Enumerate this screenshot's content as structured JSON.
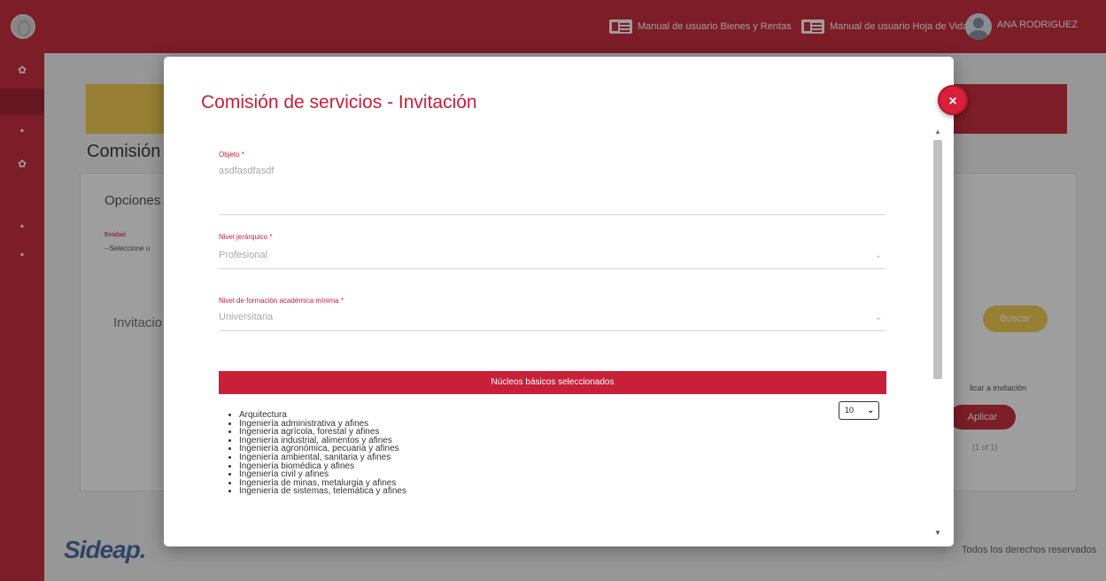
{
  "header": {
    "manual_bienes": "Manual de usuario Bienes y Rentas",
    "manual_hoja": "Manual de usuario Hoja de Vida",
    "user_name": "ANA RODRIGUEZ"
  },
  "background": {
    "page_title": "Comisión",
    "options_title": "Opciones",
    "entity_label": "Entidad",
    "entity_value": "--Seleccione u",
    "invitations_title": "Invitacio",
    "search_button": "Buscar",
    "apply_column": "licar a invitación",
    "apply_button": "Aplicar",
    "pagination": "(1 of 1)",
    "footer_logo": "Sideap.",
    "footer_rights": "Todos los derechos reservados"
  },
  "modal": {
    "title": "Comisión de servicios - Invitación",
    "close_label": "×",
    "objeto": {
      "label": "Objeto *",
      "value": "asdfasdfasdf"
    },
    "nivel_jerarquico": {
      "label": "Nivel jerárquico *",
      "value": "Profesional"
    },
    "nivel_formacion": {
      "label": "Nivel de formación académica mínima *",
      "value": "Universitaria"
    },
    "nucleos_header": "Núcleos básicos seleccionados",
    "page_size": "10",
    "nucleos": [
      "Arquitectura",
      "Ingeniería administrativa y afines",
      "Ingeniería agrícola, forestal y afines",
      "Ingeniería industrial, alimentos y afines",
      "Ingeniería agronómica, pecuaria y afines",
      "Ingeniería ambiental, sanitaria y afines",
      "Ingeniería biomédica y afines",
      "Ingeniería civil y afines",
      "Ingeniería de minas, metalurgia y afines",
      "Ingeniería de sistemas, telemática y afines"
    ]
  },
  "colors": {
    "brand_red": "#c9303f",
    "accent_yellow": "#f4cf55",
    "title_red": "#c9203a"
  },
  "icons": [
    "app-logo-icon",
    "doc-icon",
    "avatar-icon",
    "close-icon",
    "chevron-down-icon",
    "scroll-up-icon",
    "scroll-down-icon"
  ]
}
